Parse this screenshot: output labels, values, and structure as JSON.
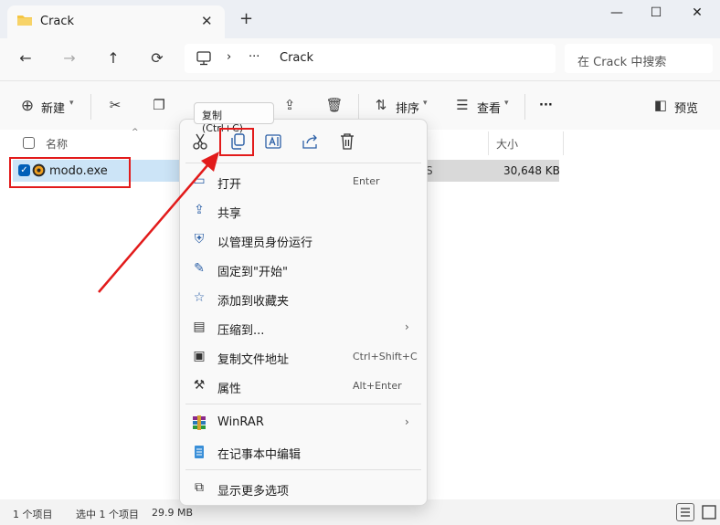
{
  "window": {
    "tab_title": "Crack",
    "tab_close": "✕",
    "new_tab": "+",
    "minimize": "—",
    "maximize": "☐",
    "close": "✕"
  },
  "address": {
    "ellipsis": "···",
    "separator": "›",
    "folder": "Crack",
    "search_placeholder": "在 Crack 中搜索"
  },
  "toolbar": {
    "new_label": "新建",
    "sort_label": "排序",
    "view_label": "查看",
    "more": "···",
    "preview_label": "预览"
  },
  "columns": {
    "name": "名称",
    "size": "大小"
  },
  "files": [
    {
      "name": "modo.exe",
      "size": "30,648 KB",
      "partial_col": "S"
    }
  ],
  "status": {
    "count": "1 个项目",
    "selected": "选中 1 个项目",
    "size": "29.9 MB"
  },
  "tooltip": "复制 (Ctrl+C)",
  "context_menu": {
    "top_icons": [
      "cut-icon",
      "copy-icon",
      "rename-icon",
      "share-icon",
      "delete-icon"
    ],
    "items": [
      {
        "label": "打开",
        "key": "Enter",
        "icon": "open-icon"
      },
      {
        "label": "共享",
        "key": "",
        "icon": "share-icon"
      },
      {
        "label": "以管理员身份运行",
        "key": "",
        "icon": "shield-icon"
      },
      {
        "label": "固定到\"开始\"",
        "key": "",
        "icon": "pin-icon"
      },
      {
        "label": "添加到收藏夹",
        "key": "",
        "icon": "star-icon"
      },
      {
        "label": "压缩到...",
        "key": "",
        "icon": "zip-icon",
        "submenu": true
      },
      {
        "label": "复制文件地址",
        "key": "Ctrl+Shift+C",
        "icon": "path-icon"
      },
      {
        "label": "属性",
        "key": "Alt+Enter",
        "icon": "wrench-icon"
      },
      {
        "label": "WinRAR",
        "key": "",
        "icon": "winrar-icon",
        "submenu": true
      },
      {
        "label": "在记事本中编辑",
        "key": "",
        "icon": "notepad-icon"
      },
      {
        "label": "显示更多选项",
        "key": "",
        "icon": "more-options-icon"
      }
    ]
  },
  "colors": {
    "accent": "#005fb8",
    "highlight": "#e21b1b",
    "selection": "#cce4f7"
  }
}
